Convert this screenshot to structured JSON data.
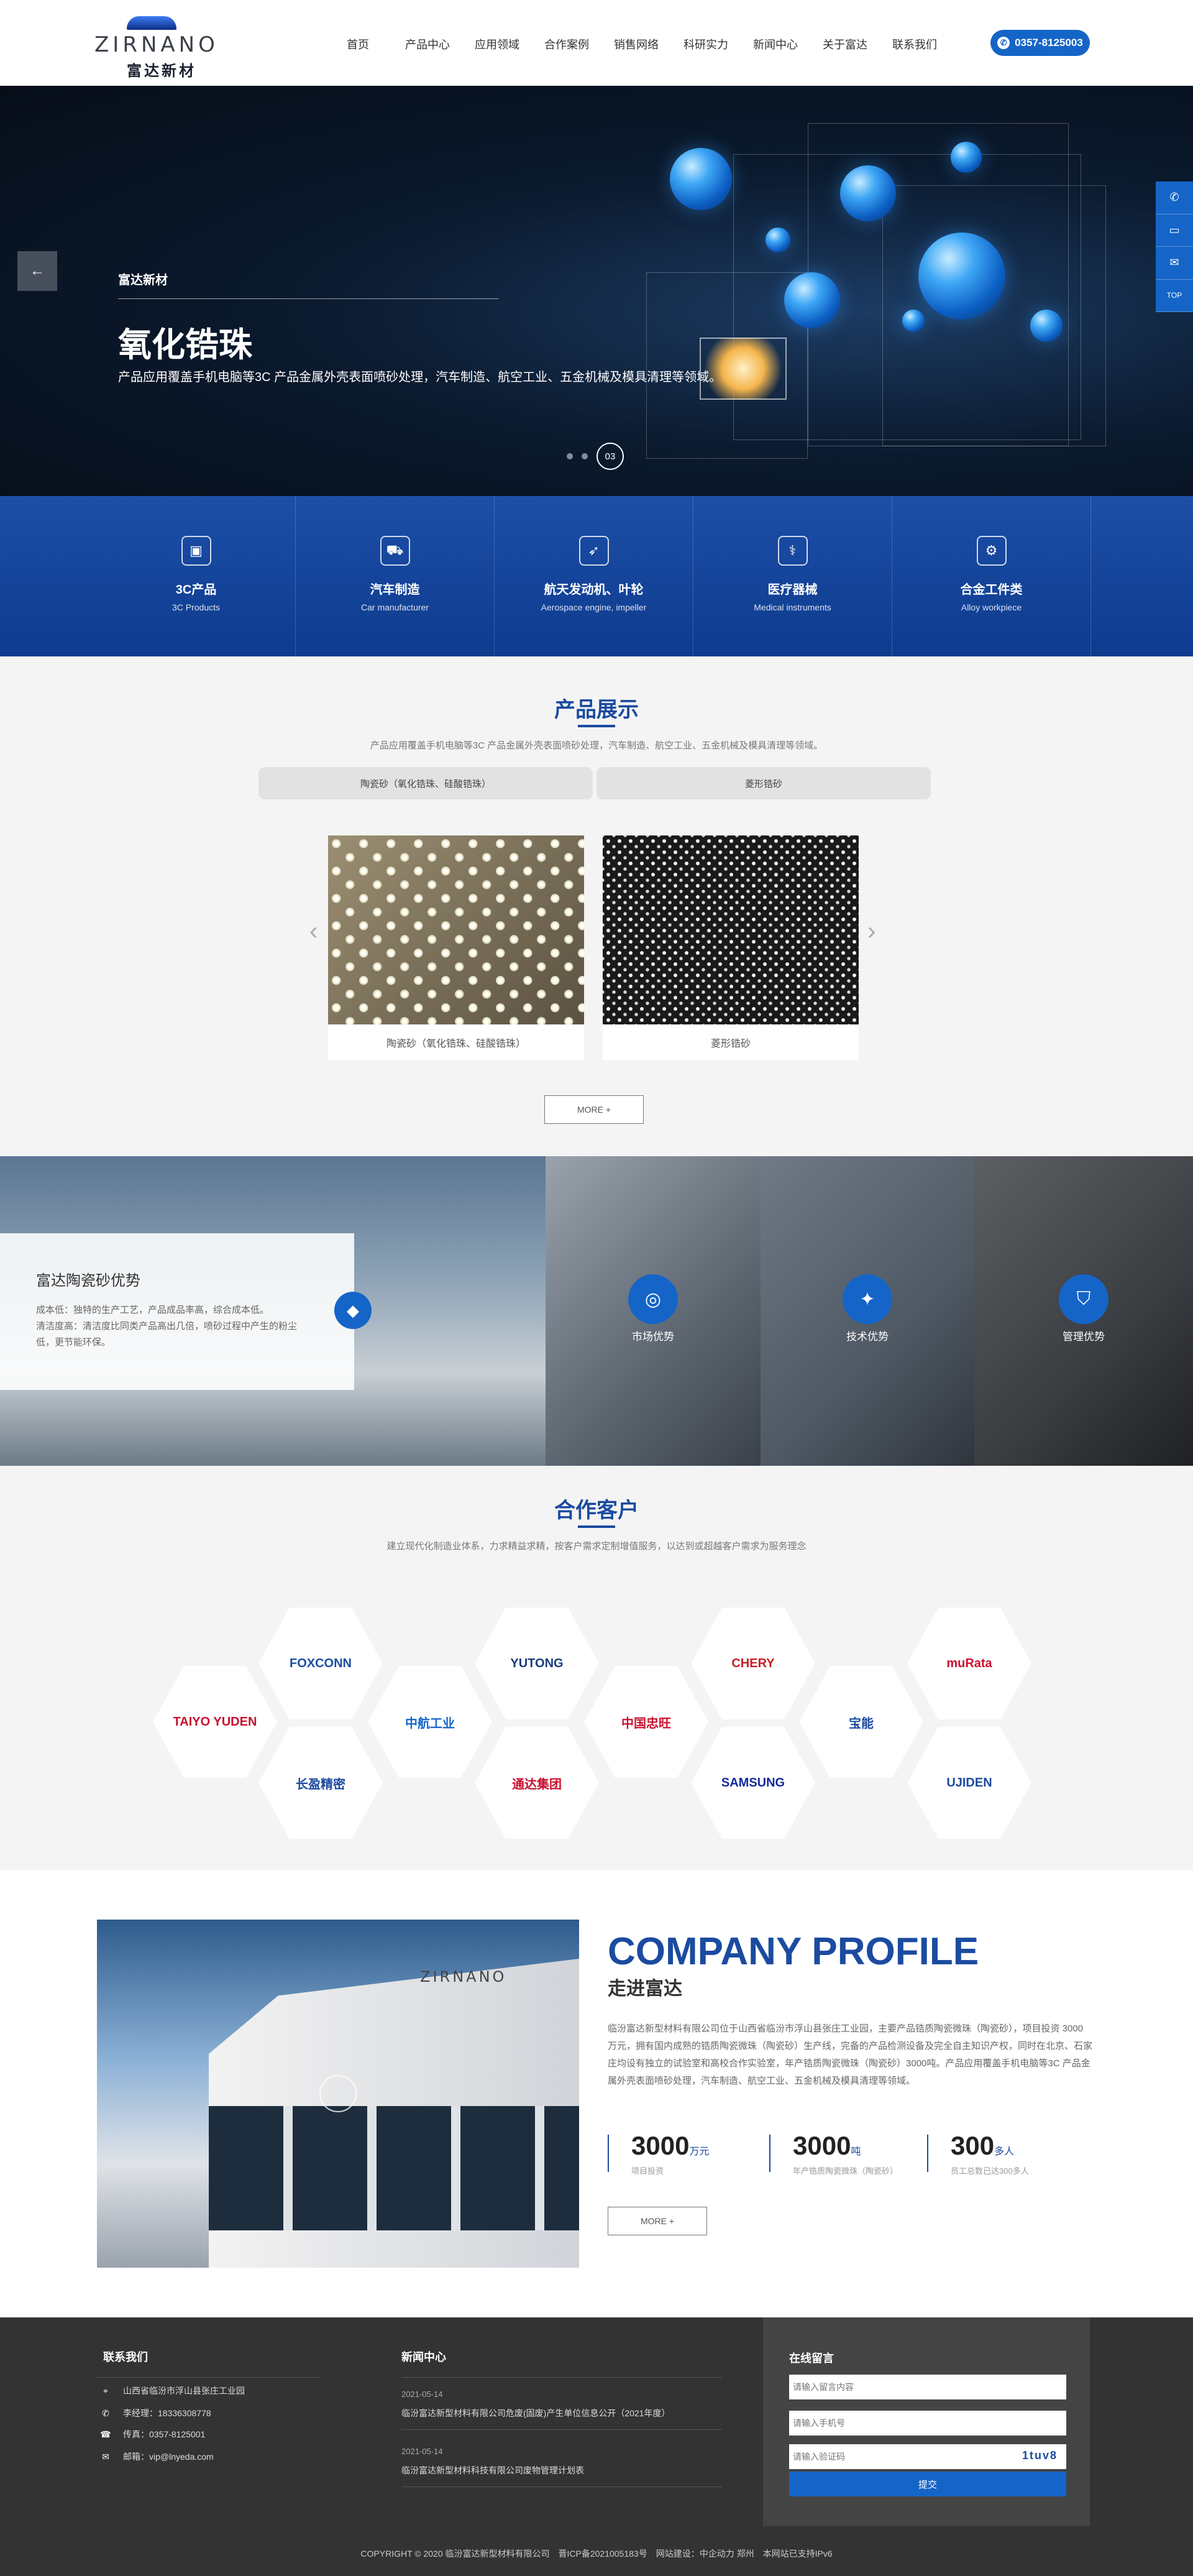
{
  "header": {
    "logo_en": "ZIRNANO",
    "logo_cn": "富达新材",
    "nav": [
      "首页",
      "产品中心",
      "应用领域",
      "合作案例",
      "销售网络",
      "科研实力",
      "新闻中心",
      "关于富达",
      "联系我们"
    ],
    "phone": "0357-8125003",
    "phone_icon": "phone-icon"
  },
  "hero": {
    "prev_icon": "arrow-left-icon",
    "subtitle": "富达新材",
    "title": "氧化锆珠",
    "description": "产品应用覆盖手机电脑等3C 产品金属外壳表面喷砂处理，汽车制造、航空工业、五金机械及模具清理等领域。",
    "slide_num": "03",
    "side_tools": {
      "icons": [
        "phone-icon",
        "chat-icon",
        "mail-icon"
      ],
      "top": "TOP"
    }
  },
  "categories": [
    {
      "icon": "chart-icon",
      "title": "3C产品",
      "subtitle": "3C Products"
    },
    {
      "icon": "car-icon",
      "title": "汽车制造",
      "subtitle": "Car manufacturer"
    },
    {
      "icon": "rocket-icon",
      "title": "航天发动机、叶轮",
      "subtitle": "Aerospace engine, impeller"
    },
    {
      "icon": "stethoscope-icon",
      "title": "医疗器械",
      "subtitle": "Medical instruments"
    },
    {
      "icon": "gear-icon",
      "title": "合金工件类",
      "subtitle": "Alloy workpiece"
    }
  ],
  "products": {
    "title": "产品展示",
    "description": "产品应用覆盖手机电脑等3C 产品金属外壳表面喷砂处理，汽车制造、航空工业、五金机械及模具清理等领域。",
    "tabs": [
      "陶瓷砂（氧化锆珠、硅酸锆珠）",
      "菱形锆砂"
    ],
    "items": [
      {
        "caption": "陶瓷砂（氧化锆珠、硅酸锆珠）"
      },
      {
        "caption": "菱形锆砂"
      }
    ],
    "more": "MORE +"
  },
  "advantages": {
    "title": "富达陶瓷砂优势",
    "text_1": "成本低：独特的生产工艺，产品成品率高，综合成本低。",
    "text_2": "清洁度高：清洁度比同类产品高出几倍，喷砂过程中产生的粉尘低，更节能环保。",
    "items": [
      {
        "icon": "globe-icon",
        "label": "市场优势"
      },
      {
        "icon": "bulb-icon",
        "label": "技术优势"
      },
      {
        "icon": "shield-icon",
        "label": "管理优势"
      }
    ]
  },
  "clients": {
    "title": "合作客户",
    "description": "建立现代化制造业体系，力求精益求精，按客户需求定制增值服务，以达到或超越客户需求为服务理念",
    "logos": [
      {
        "name": "FOXCONN",
        "color": "#1a4ea3"
      },
      {
        "name": "YUTONG",
        "color": "#1a3c7c"
      },
      {
        "name": "CHERY",
        "color": "#c51f2b"
      },
      {
        "name": "muRata",
        "color": "#c8102e"
      },
      {
        "name": "TAIYO YUDEN",
        "color": "#c8102e"
      },
      {
        "name": "中航工业",
        "color": "#1565c8"
      },
      {
        "name": "中国忠旺",
        "color": "#c8102e"
      },
      {
        "name": "宝能",
        "color": "#1b4ba0"
      },
      {
        "name": "长盈精密",
        "color": "#1b4ba0"
      },
      {
        "name": "通达集团",
        "color": "#c8102e"
      },
      {
        "name": "SAMSUNG",
        "color": "#1428a0"
      },
      {
        "name": "UJIDEN",
        "color": "#1b4ba0"
      }
    ]
  },
  "profile": {
    "title_en": "COMPANY PROFILE",
    "title_cn": "走进富达",
    "building_sign": "ZIRNANO",
    "text": "临汾富达新型材料有限公司位于山西省临汾市浮山县张庄工业园，主要产品锆质陶瓷微珠（陶瓷砂），项目投资 3000万元，拥有国内成熟的锆质陶瓷微珠（陶瓷砂）生产线，完备的产品检测设备及完全自主知识产权，同时在北京、石家庄均设有独立的试验室和高校合作实验室，年产锆质陶瓷微珠（陶瓷砂）3000吨。产品应用覆盖手机电脑等3C 产品金属外壳表面喷砂处理，汽车制造、航空工业、五金机械及模具清理等领域。",
    "stats": [
      {
        "num": "3000",
        "unit": "万元",
        "label": "项目投资"
      },
      {
        "num": "3000",
        "unit": "吨",
        "label": "年产锆质陶瓷微珠（陶瓷砂）"
      },
      {
        "num": "300",
        "unit": "多人",
        "label": "员工总数已达300多人"
      }
    ],
    "more": "MORE +"
  },
  "footer": {
    "contact_title": "联系我们",
    "contact": [
      {
        "icon": "location-icon",
        "text": "山西省临汾市浮山县张庄工业园"
      },
      {
        "icon": "phone-icon",
        "text": "李经理：18336308778"
      },
      {
        "icon": "fax-icon",
        "text": "传真：0357-8125001"
      },
      {
        "icon": "mail-icon",
        "text": "邮箱：vip@lnyeda.com"
      }
    ],
    "news_title": "新闻中心",
    "news": [
      {
        "date": "2021-05-14",
        "title": "临汾富达新型材料有限公司危废(固废)产生单位信息公开（2021年度）"
      },
      {
        "date": "2021-05-14",
        "title": "临汾富达新型材料科技有限公司废物管理计划表"
      }
    ],
    "message_title": "在线留言",
    "msg_placeholder": "请输入留言内容",
    "phone_placeholder": "请输入手机号",
    "code_placeholder": "请输入验证码",
    "captcha": "1tuv8",
    "submit": "提交",
    "copyright": "COPYRIGHT © 2020 临汾富达新型材料有限公司　晋ICP备2021005183号　网站建设：中企动力 郑州　本网站已支持IPv6"
  }
}
